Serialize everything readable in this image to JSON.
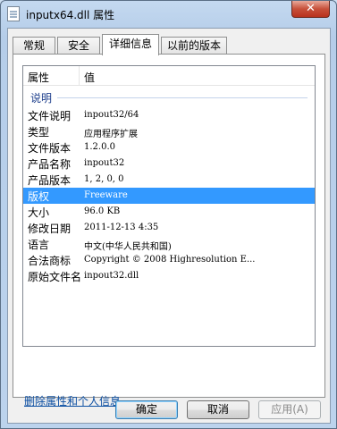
{
  "window": {
    "title": "inputx64.dll 属性",
    "close_glyph": "✕"
  },
  "tabs": [
    {
      "label": "常规"
    },
    {
      "label": "安全"
    },
    {
      "label": "详细信息"
    },
    {
      "label": "以前的版本"
    }
  ],
  "active_tab": "详细信息",
  "details": {
    "col_property": "属性",
    "col_value": "值",
    "group_label": "说明",
    "rows": [
      {
        "key": "文件说明",
        "value": "inpout32/64"
      },
      {
        "key": "类型",
        "value": "应用程序扩展"
      },
      {
        "key": "文件版本",
        "value": "1.2.0.0"
      },
      {
        "key": "产品名称",
        "value": "inpout32"
      },
      {
        "key": "产品版本",
        "value": "1, 2, 0, 0"
      },
      {
        "key": "版权",
        "value": "Freeware"
      },
      {
        "key": "大小",
        "value": "96.0 KB"
      },
      {
        "key": "修改日期",
        "value": "2011-12-13 4:35"
      },
      {
        "key": "语言",
        "value": "中文(中华人民共和国)"
      },
      {
        "key": "合法商标",
        "value": "Copyright © 2008 Highresolution E..."
      },
      {
        "key": "原始文件名",
        "value": "inpout32.dll"
      }
    ],
    "selected_row": "版权"
  },
  "remove_link": "删除属性和个人信息",
  "buttons": {
    "ok": "确定",
    "cancel": "取消",
    "apply": "应用(A)"
  },
  "colors": {
    "selection": "#3399ff",
    "link": "#0b4ea2",
    "group_label": "#1e3f8c"
  }
}
